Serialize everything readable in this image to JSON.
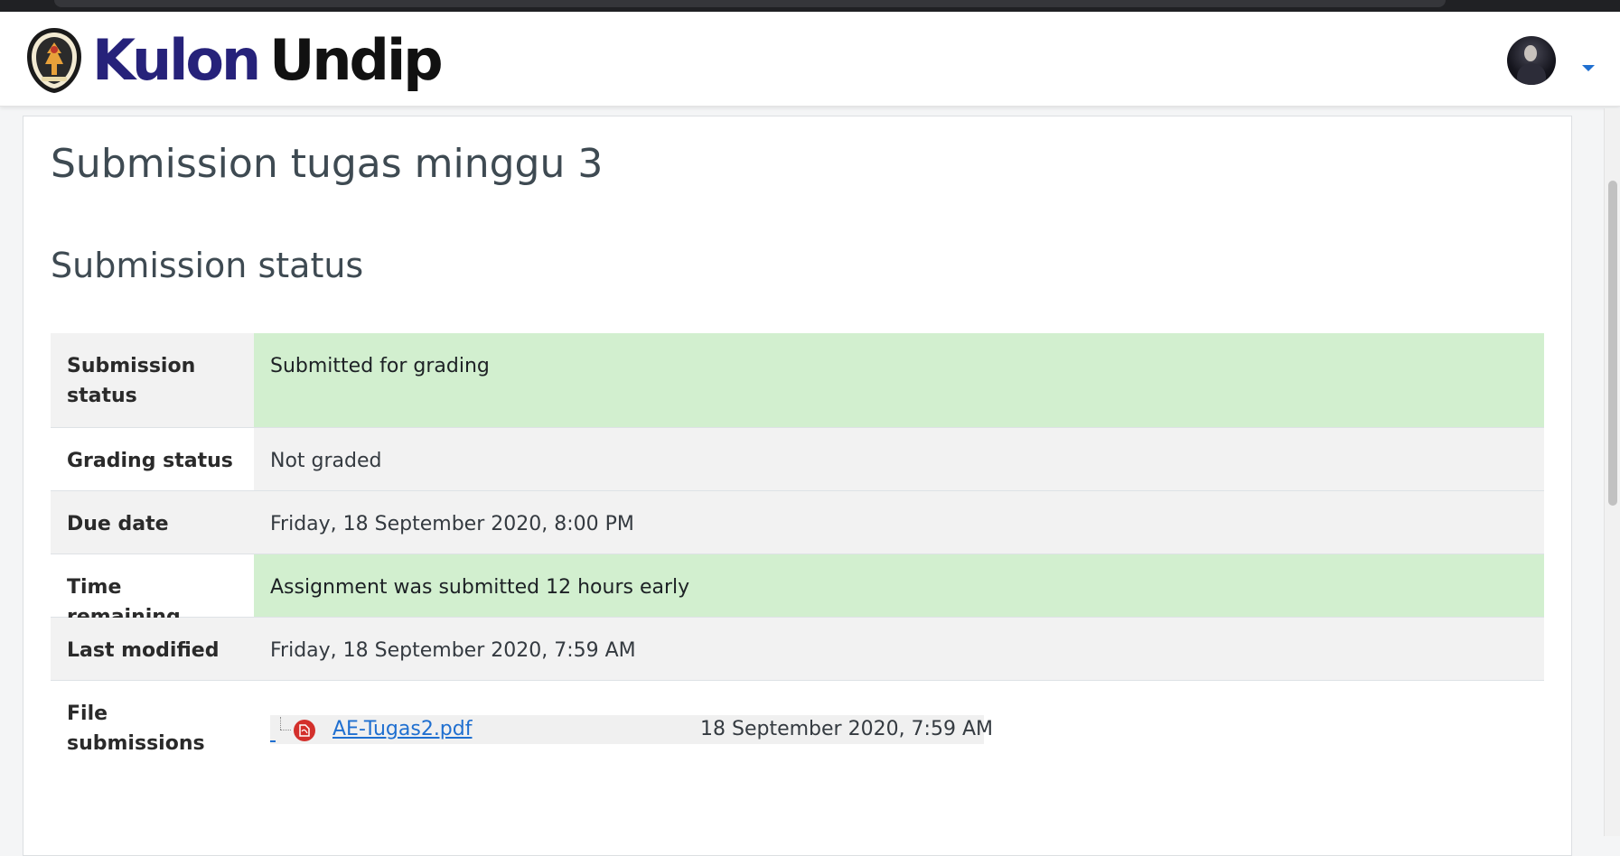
{
  "brand": {
    "part1": "Kulon",
    "part2": "Undip"
  },
  "colors": {
    "brand_navy": "#26227a",
    "link_blue": "#1f6fd0",
    "success_bg": "#d2efcf",
    "pdf_red": "#d3302c"
  },
  "page": {
    "title": "Submission tugas minggu 3",
    "section_title": "Submission status"
  },
  "status_table": {
    "rows": [
      {
        "label": "Submission status",
        "value": "Submitted for grading"
      },
      {
        "label": "Grading status",
        "value": "Not graded"
      },
      {
        "label": "Due date",
        "value": "Friday, 18 September 2020, 8:00 PM"
      },
      {
        "label": "Time remaining",
        "value": "Assignment was submitted 12 hours early"
      },
      {
        "label": "Last modified",
        "value": "Friday, 18 September 2020, 7:59 AM"
      },
      {
        "label": "File submissions",
        "value": ""
      }
    ]
  },
  "file_submission": {
    "file_name": "AE-Tugas2.pdf",
    "file_date": "18 September 2020, 7:59 AM",
    "icon": "pdf-file-icon"
  },
  "user_menu": {
    "icon": "chevron-down-icon"
  }
}
